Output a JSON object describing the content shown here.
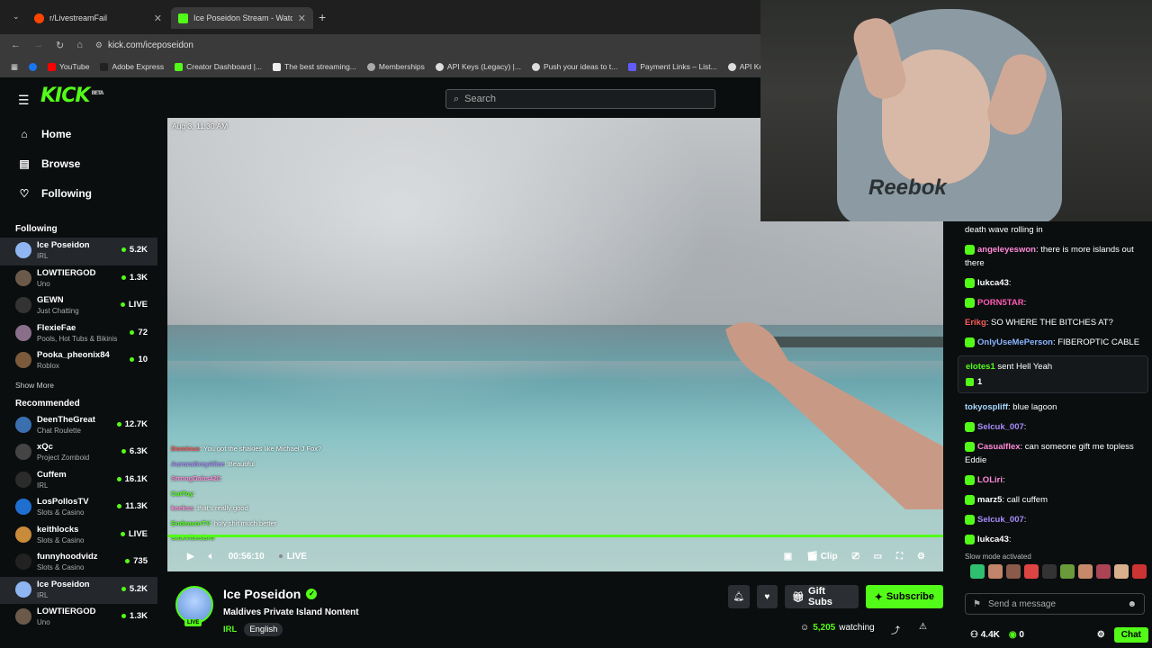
{
  "browser": {
    "tabs": [
      {
        "label": "r/LivestreamFail",
        "color": "#ff4500"
      },
      {
        "label": "Ice Poseidon Stream - Watch Li",
        "color": "#53fc18"
      }
    ],
    "url": "kick.com/iceposeidon",
    "bookmarks": [
      "YouTube",
      "Adobe Express",
      "Creator Dashboard |...",
      "The best streaming...",
      "Memberships",
      "API Keys (Legacy) |...",
      "Push your ideas to t...",
      "Payment Links – List...",
      "API Keys - Re"
    ]
  },
  "header": {
    "logo": "KICK",
    "logo_badge": "BETA",
    "search_placeholder": "Search"
  },
  "sidebar": {
    "nav": [
      {
        "label": "Home",
        "icon": "home-icon"
      },
      {
        "label": "Browse",
        "icon": "browse-icon"
      },
      {
        "label": "Following",
        "icon": "heart-icon"
      }
    ],
    "following_title": "Following",
    "following": [
      {
        "name": "Ice Poseidon",
        "category": "IRL",
        "viewers": "5.2K",
        "color": "#8fb6f2"
      },
      {
        "name": "LOWTIERGOD",
        "category": "Uno",
        "viewers": "1.3K",
        "color": "#6b5a4a"
      },
      {
        "name": "GEWN",
        "category": "Just Chatting",
        "viewers": "LIVE",
        "color": "#333333"
      },
      {
        "name": "FlexieFae",
        "category": "Pools, Hot Tubs & Bikinis",
        "viewers": "72",
        "color": "#8a6f8a"
      },
      {
        "name": "Pooka_pheonix84",
        "category": "Roblox",
        "viewers": "10",
        "color": "#7a5a3a"
      }
    ],
    "show_more": "Show More",
    "recommended_title": "Recommended",
    "recommended": [
      {
        "name": "DeenTheGreat",
        "category": "Chat Roulette",
        "viewers": "12.7K",
        "color": "#3a6fb0"
      },
      {
        "name": "xQc",
        "category": "Project Zomboid",
        "viewers": "6.3K",
        "color": "#444444"
      },
      {
        "name": "Cuffem",
        "category": "IRL",
        "viewers": "16.1K",
        "color": "#2b2b2b"
      },
      {
        "name": "LosPollosTV",
        "category": "Slots & Casino",
        "viewers": "11.3K",
        "color": "#1f6fd0"
      },
      {
        "name": "keithlocks",
        "category": "Slots & Casino",
        "viewers": "LIVE",
        "color": "#c98a3a"
      },
      {
        "name": "funnyhoodvidz",
        "category": "Slots & Casino",
        "viewers": "735",
        "color": "#222222"
      },
      {
        "name": "Ice Poseidon",
        "category": "IRL",
        "viewers": "5.2K",
        "color": "#8fb6f2"
      },
      {
        "name": "LOWTIERGOD",
        "category": "Uno",
        "viewers": "1.3K",
        "color": "#6b5a4a"
      }
    ]
  },
  "video": {
    "timestamp": "Aug 3, 11:30 AM",
    "elapsed": "00:56:10",
    "live_label": "LIVE",
    "clip_label": "Clip",
    "overlay_chat": [
      {
        "user": "Dominus",
        "text": ": You got the shakies like Michael J Fox?",
        "color": "#ff5a5a"
      },
      {
        "user": "AuroraGreyAlice",
        "text": ": Beautiful",
        "color": "#a78bfa"
      },
      {
        "user": "StrongDabs420",
        "text": ":",
        "color": "#ff8ad8"
      },
      {
        "user": "CatToy",
        "text": ":",
        "color": "#53fc18"
      },
      {
        "user": "keekss",
        "text": ": that's really good",
        "color": "#ff8ad8"
      },
      {
        "user": "EndeavorTV",
        "text": ": holy shit much better",
        "color": "#53fc18"
      },
      {
        "user": "SickVibesBro",
        "text": "",
        "color": "#53fc18"
      }
    ]
  },
  "stream": {
    "streamer": "Ice Poseidon",
    "live_badge": "LIVE",
    "title": "Maldives Private Island Nontent",
    "category": "IRL",
    "language": "English",
    "gift_label": "Gift Subs",
    "subscribe_label": "Subscribe",
    "viewers": "5,205",
    "watching_label": "watching"
  },
  "chat": {
    "messages": [
      {
        "user": "",
        "text": "death wave rolling in",
        "color": "#ffffff",
        "badge": ""
      },
      {
        "user": "angeleyeswon",
        "text": ": there is more islands out there",
        "color": "#ff8ad8",
        "badge": "30"
      },
      {
        "user": "lukca43",
        "text": ":",
        "color": "#ffffff",
        "badge": "41"
      },
      {
        "user": "PORN5TAR",
        "text": ":",
        "color": "#ff5ab4",
        "badge": "40"
      },
      {
        "user": "Erikg",
        "text": ": SO WHERE THE BITCHES AT?",
        "color": "#ff5a5a",
        "badge": ""
      },
      {
        "user": "OnlyUseMePerson",
        "text": ": FIBEROPTIC CABLE",
        "color": "#8ab4ff",
        "badge": "33"
      }
    ],
    "gift": {
      "user": "elotes1",
      "text": " sent Hell Yeah",
      "count": "1"
    },
    "messages2": [
      {
        "user": "tokyospliff",
        "text": ": blue lagoon",
        "color": "#a7d8ff",
        "badge": ""
      },
      {
        "user": "Selcuk_007",
        "text": ":",
        "color": "#a78bfa",
        "badge": "V"
      },
      {
        "user": "Casualflex",
        "text": ": can someone gift me topless Eddie",
        "color": "#ff8ad8",
        "badge": "A"
      },
      {
        "user": "LOLiri",
        "text": ":",
        "color": "#ff8ad8",
        "badge": "A"
      },
      {
        "user": "marz5",
        "text": ": call cuffem",
        "color": "#ffffff",
        "badge": "37"
      },
      {
        "user": "Selcuk_007",
        "text": ":",
        "color": "#a78bfa",
        "badge": "V"
      },
      {
        "user": "lukca43",
        "text": ":",
        "color": "#ffffff",
        "badge": "41"
      }
    ],
    "slow_mode": "Slow mode activated",
    "input_placeholder": "Send a message",
    "footer": {
      "kicks": "4.4K",
      "points": "0",
      "chat_label": "Chat"
    }
  }
}
